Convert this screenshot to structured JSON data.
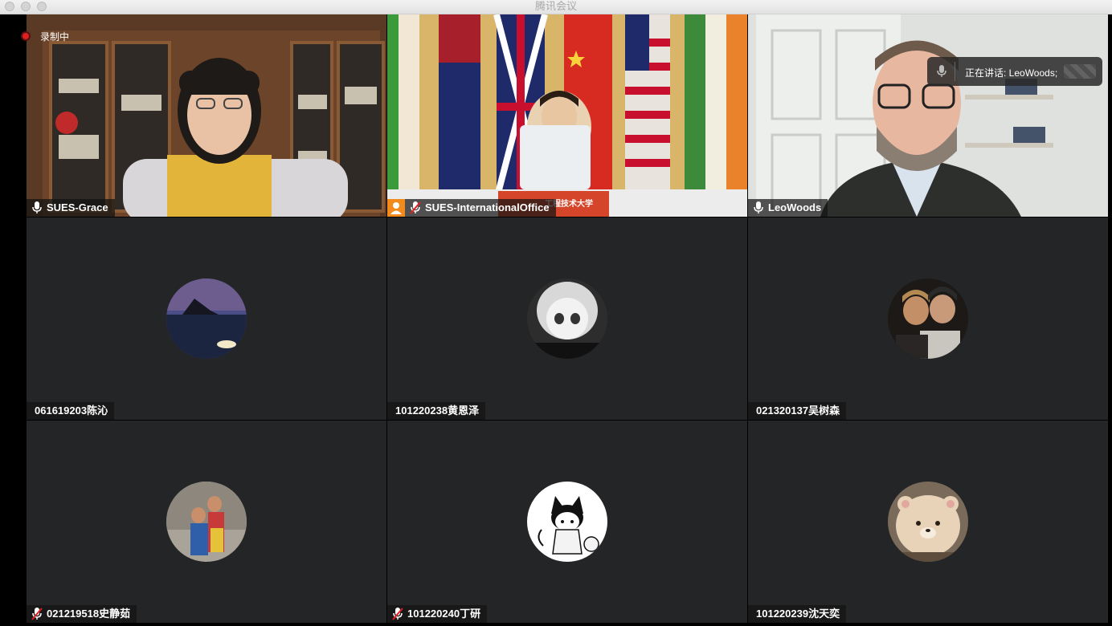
{
  "window": {
    "title": "腾讯会议"
  },
  "recording": {
    "label": "录制中"
  },
  "speaking": {
    "text": "正在讲话: LeoWoods;"
  },
  "tiles": [
    {
      "name": "SUES-Grace",
      "mic": "on"
    },
    {
      "name": "SUES-InternationalOffice",
      "mic": "muted"
    },
    {
      "name": "LeoWoods",
      "mic": "on"
    },
    {
      "name": "061619203陈沁",
      "mic": "none"
    },
    {
      "name": "101220238黄恩泽",
      "mic": "none"
    },
    {
      "name": "021320137吴树森",
      "mic": "none"
    },
    {
      "name": "021219518史静茹",
      "mic": "muted"
    },
    {
      "name": "101220240丁研",
      "mic": "muted"
    },
    {
      "name": "101220239沈天奕",
      "mic": "none"
    }
  ],
  "office_banner": "工程技术大学",
  "colors": {
    "active_speaker": "#2ecc40",
    "recording": "#e02020",
    "muted": "#e02020"
  }
}
